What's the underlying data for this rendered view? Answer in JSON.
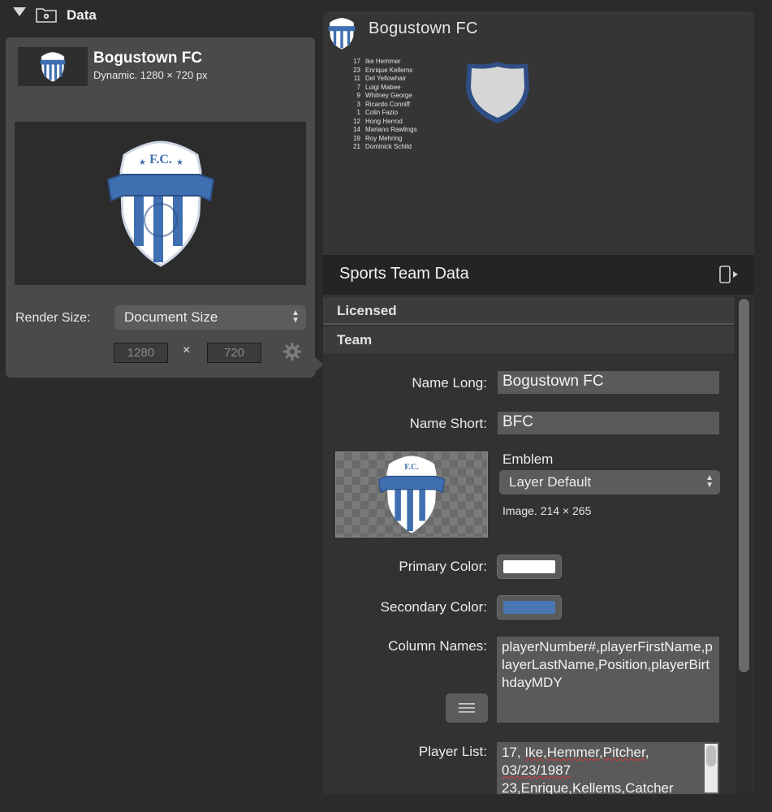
{
  "sidebar": {
    "section_title": "Data",
    "card": {
      "title": "Bogustown FC",
      "subtitle": "Dynamic. 1280 × 720 px",
      "render_size_label": "Render Size:",
      "render_size_value": "Document Size",
      "width_value": "1280",
      "height_value": "720",
      "dim_separator": "×"
    }
  },
  "preview": {
    "team_name": "Bogustown FC",
    "roster": [
      {
        "number": "17",
        "name": "Ike Hemmer"
      },
      {
        "number": "23",
        "name": "Enrique Kellems"
      },
      {
        "number": "11",
        "name": "Del Yellowhair"
      },
      {
        "number": "7",
        "name": "Luigi Mabee"
      },
      {
        "number": "9",
        "name": "Whitney George"
      },
      {
        "number": "3",
        "name": "Ricardo Conniff"
      },
      {
        "number": "1",
        "name": "Colin Fazio"
      },
      {
        "number": "12",
        "name": "Hong Herrod"
      },
      {
        "number": "14",
        "name": "Mariano Rawlings"
      },
      {
        "number": "19",
        "name": "Roy Mehring"
      },
      {
        "number": "21",
        "name": "Dominick Schild"
      }
    ]
  },
  "inspector": {
    "title": "Sports Team Data",
    "groups": {
      "licensed": "Licensed",
      "team": "Team"
    },
    "fields": {
      "name_long_label": "Name Long:",
      "name_long_value": "Bogustown FC",
      "name_short_label": "Name Short:",
      "name_short_value": "BFC",
      "emblem_label": "Emblem",
      "emblem_value": "Layer Default",
      "emblem_info": "Image. 214 × 265",
      "primary_color_label": "Primary Color:",
      "primary_color": "#ffffff",
      "secondary_color_label": "Secondary Color:",
      "secondary_color": "#4a77b4",
      "column_names_label": "Column Names:",
      "column_names_value": "playerNumber#,playerFirstName,playerLastName,Position,playerBirthdayMDY",
      "player_list_label": "Player List:",
      "player_list_line1": "17,",
      "player_list_line1b": "Ike,Hemmer,Pitcher,",
      "player_list_line2": "03/23/1987",
      "player_list_line3": "23,Enrique,Kellems,Catcher"
    }
  },
  "icons": [
    "disclosure-triangle-icon",
    "folder-gear-icon",
    "team-crest-icon",
    "gear-icon",
    "shield-icon",
    "panel-toggle-icon",
    "text-list-icon",
    "chevron-updown-icon"
  ],
  "colors": {
    "brand_blue": "#3f6fb0",
    "panel_bg": "#323232"
  }
}
